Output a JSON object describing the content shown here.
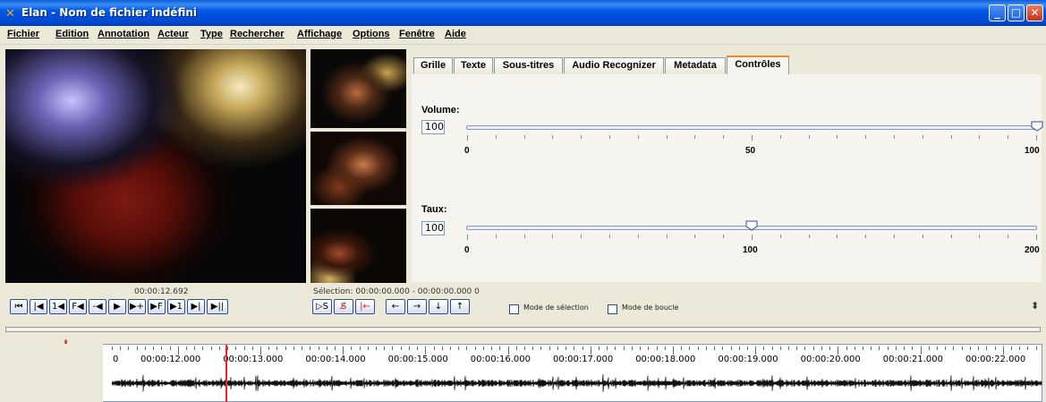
{
  "window": {
    "title": "Elan - Nom de fichier indéfini",
    "controls": [
      "minimize",
      "maximize",
      "close"
    ]
  },
  "menu": [
    {
      "label": "Fichier"
    },
    {
      "label": "Edition"
    },
    {
      "label": "Annotation"
    },
    {
      "label": "Acteur"
    },
    {
      "label": "Type"
    },
    {
      "label": "Rechercher"
    },
    {
      "label": "Affichage"
    },
    {
      "label": "Options"
    },
    {
      "label": "Fenêtre"
    },
    {
      "label": "Aide"
    }
  ],
  "tabs": [
    {
      "label": "Grille"
    },
    {
      "label": "Texte"
    },
    {
      "label": "Sous-titres"
    },
    {
      "label": "Audio Recognizer"
    },
    {
      "label": "Metadata"
    },
    {
      "label": "Contrôles",
      "active": true
    }
  ],
  "volume": {
    "label": "Volume:",
    "value": "100",
    "min": "0",
    "mid": "50",
    "max": "100",
    "position_fraction": 1.0
  },
  "rate": {
    "label": "Taux:",
    "value": "100",
    "min": "0",
    "mid": "100",
    "max": "200",
    "position_fraction": 0.5
  },
  "player": {
    "time": "00:00:12.692",
    "selection": "Sélection: 00:00:00.000 - 00:00:00.000  0"
  },
  "media_buttons": [
    {
      "glyph": "⏮︎",
      "icon": "go-to-begin-icon"
    },
    {
      "glyph": "|◀",
      "icon": "previous-scrollview-icon"
    },
    {
      "glyph": "1◀",
      "icon": "previous-second-icon"
    },
    {
      "glyph": "F◀",
      "icon": "previous-frame-icon"
    },
    {
      "glyph": "-◀",
      "icon": "step-backward-icon"
    },
    {
      "glyph": "▶",
      "icon": "play-pause-icon"
    },
    {
      "glyph": "▶+",
      "icon": "step-forward-icon"
    },
    {
      "glyph": "▶F",
      "icon": "next-frame-icon"
    },
    {
      "glyph": "▶1",
      "icon": "next-second-icon"
    },
    {
      "glyph": "▶|",
      "icon": "next-scrollview-icon"
    },
    {
      "glyph": "▶||",
      "icon": "go-to-end-icon"
    }
  ],
  "selection_buttons": [
    {
      "glyph": "▷S",
      "icon": "play-selection-icon"
    },
    {
      "glyph": "S̸",
      "icon": "clear-selection-icon"
    },
    {
      "glyph": "|←",
      "icon": "to-selection-begin-icon"
    }
  ],
  "arrow_buttons": [
    {
      "glyph": "←",
      "icon": "arrow-left-icon"
    },
    {
      "glyph": "→",
      "icon": "arrow-right-icon"
    },
    {
      "glyph": "↓",
      "icon": "arrow-down-icon"
    },
    {
      "glyph": "↑",
      "icon": "arrow-up-icon"
    }
  ],
  "modes": {
    "selection_mode": {
      "label": "Mode de sélection",
      "checked": false
    },
    "loop_mode": {
      "label": "Mode de boucle",
      "checked": false
    }
  },
  "timeline": {
    "zero": "0",
    "labels": [
      "00:00:12.000",
      "00:00:13.000",
      "00:00:14.000",
      "00:00:15.000",
      "00:00:16.000",
      "00:00:17.000",
      "00:00:18.000",
      "00:00:19.000",
      "00:00:20.000",
      "00:00:21.000",
      "00:00:22.000"
    ]
  },
  "colors": {
    "title_bar": "#0058e6",
    "active_tab_accent": "#e68b2c",
    "cursor": "#e8261e",
    "slider_track": "#8a9bb6"
  }
}
